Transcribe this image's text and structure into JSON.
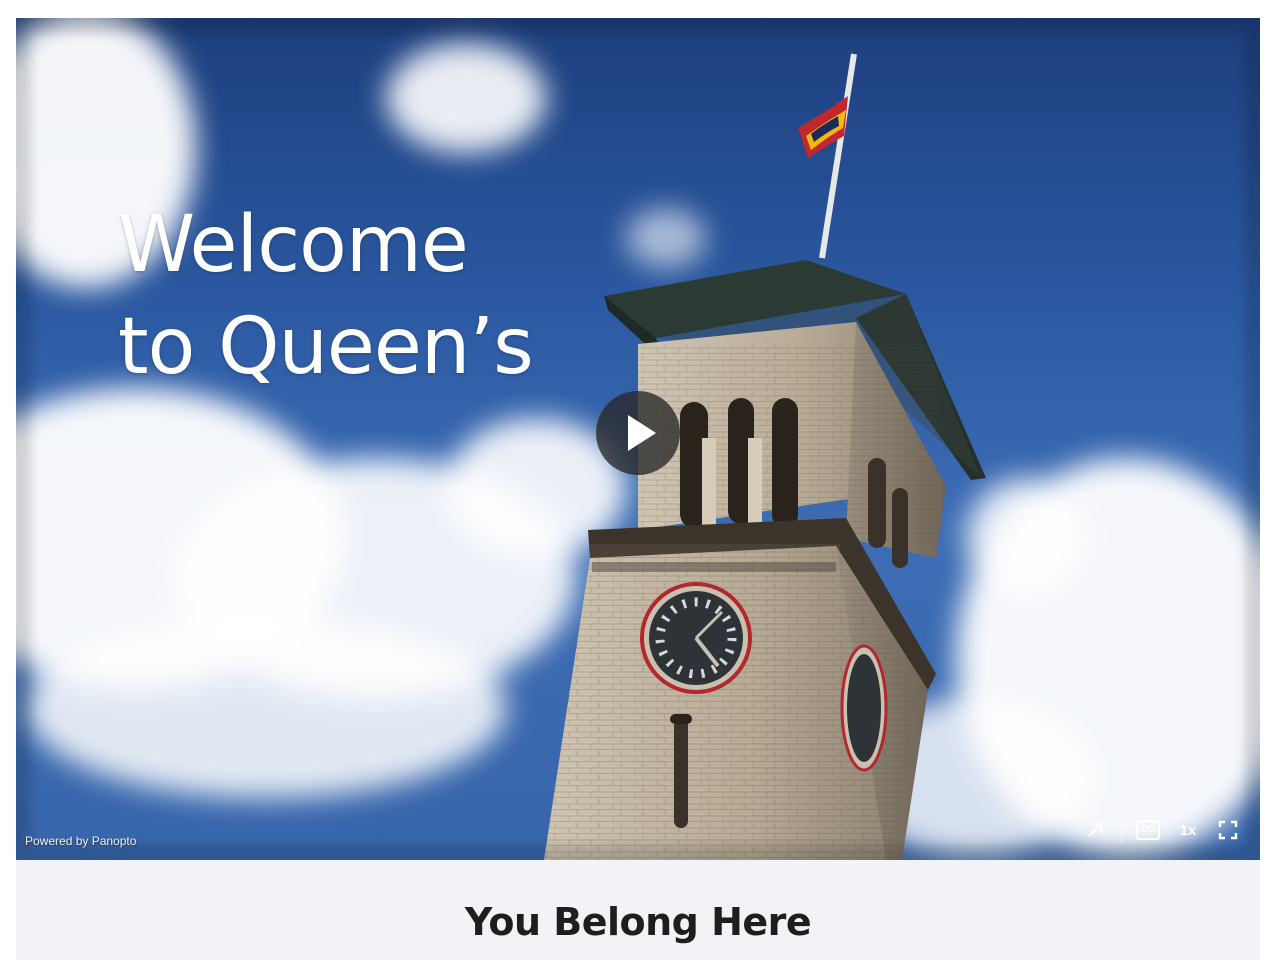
{
  "video": {
    "title_line1": "Welcome",
    "title_line2": "to Queen’s",
    "play_icon": "play-icon",
    "powered_by": "Powered by Panopto",
    "controls": {
      "share_icon": "share-arrow-icon",
      "captions_label": "CC",
      "speed_label": "1x",
      "fullscreen_icon": "fullscreen-icon"
    }
  },
  "section": {
    "heading": "You Belong Here"
  },
  "colors": {
    "sky": "#2c5aa3",
    "panel_background": "#f2f3f6",
    "heading_text": "#1e1e1e",
    "clock_rim": "#b3282c"
  }
}
